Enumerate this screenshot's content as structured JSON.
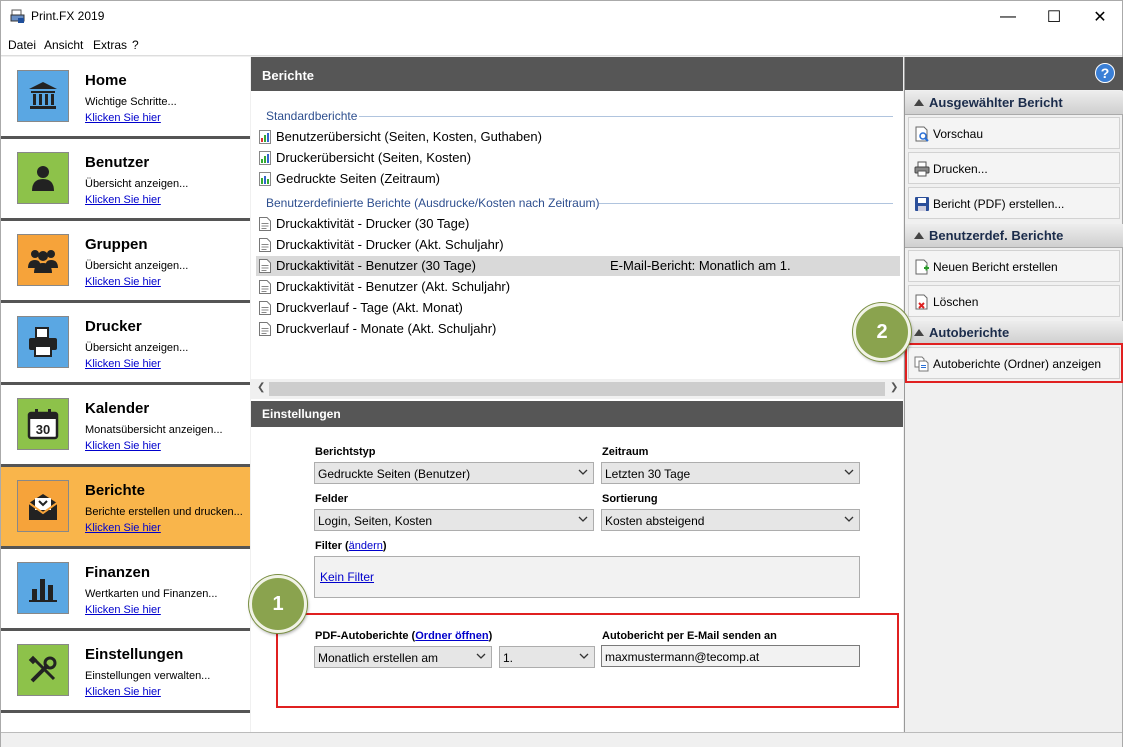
{
  "window": {
    "title": "Print.FX 2019",
    "minimize": "—",
    "maximize": "☐",
    "close": "✕"
  },
  "menu": [
    "Datei",
    "Ansicht",
    "Extras",
    "?"
  ],
  "nav": [
    {
      "title": "Home",
      "desc": "Wichtige Schritte...",
      "link": "Klicken Sie hier",
      "color": "#5aa7e3",
      "icon": "bank-icon"
    },
    {
      "title": "Benutzer",
      "desc": "Übersicht anzeigen...",
      "link": "Klicken Sie hier",
      "color": "#8dc24a",
      "icon": "user-icon"
    },
    {
      "title": "Gruppen",
      "desc": "Übersicht anzeigen...",
      "link": "Klicken Sie hier",
      "color": "#f6a33a",
      "icon": "group-icon"
    },
    {
      "title": "Drucker",
      "desc": "Übersicht anzeigen...",
      "link": "Klicken Sie hier",
      "color": "#5aa7e3",
      "icon": "printer-icon"
    },
    {
      "title": "Kalender",
      "desc": "Monatsübersicht anzeigen...",
      "link": "Klicken Sie hier",
      "color": "#8dc24a",
      "icon": "calendar-icon"
    },
    {
      "title": "Berichte",
      "desc": "Berichte erstellen und drucken...",
      "link": "Klicken Sie hier",
      "color": "#f6a33a",
      "icon": "report-icon",
      "active": true
    },
    {
      "title": "Finanzen",
      "desc": "Wertkarten und Finanzen...",
      "link": "Klicken Sie hier",
      "color": "#5aa7e3",
      "icon": "finance-icon"
    },
    {
      "title": "Einstellungen",
      "desc": "Einstellungen verwalten...",
      "link": "Klicken Sie hier",
      "color": "#8dc24a",
      "icon": "tools-icon"
    }
  ],
  "reports": {
    "header": "Berichte",
    "standard_heading": "Standardberichte",
    "standard": [
      "Benutzerübersicht (Seiten, Kosten, Guthaben)",
      "Druckerübersicht (Seiten, Kosten)",
      "Gedruckte Seiten (Zeitraum)"
    ],
    "custom_heading": "Benutzerdefinierte Berichte (Ausdrucke/Kosten nach Zeitraum)",
    "custom": [
      {
        "label": "Druckaktivität - Drucker (30 Tage)",
        "email": ""
      },
      {
        "label": "Druckaktivität - Drucker (Akt. Schuljahr)",
        "email": ""
      },
      {
        "label": "Druckaktivität - Benutzer (30 Tage)",
        "email": "E-Mail-Bericht: Monatlich am 1.",
        "selected": true
      },
      {
        "label": "Druckaktivität - Benutzer (Akt. Schuljahr)",
        "email": ""
      },
      {
        "label": "Druckverlauf - Tage (Akt. Monat)",
        "email": ""
      },
      {
        "label": "Druckverlauf - Monate (Akt. Schuljahr)",
        "email": ""
      }
    ]
  },
  "settings": {
    "header": "Einstellungen",
    "berichtstyp_label": "Berichtstyp",
    "berichtstyp_value": "Gedruckte Seiten (Benutzer)",
    "zeitraum_label": "Zeitraum",
    "zeitraum_value": "Letzten 30 Tage",
    "felder_label": "Felder",
    "felder_value": "Login, Seiten, Kosten",
    "sortierung_label": "Sortierung",
    "sortierung_value": "Kosten absteigend",
    "filter_label": "Filter (",
    "filter_change": "ändern",
    "filter_close": ")",
    "filter_value": "Kein Filter",
    "pdf_label": "PDF-Autoberichte (",
    "pdf_link": "Ordner öffnen",
    "pdf_close": ")",
    "pdf_mode": "Monatlich erstellen am",
    "pdf_day": "1.",
    "email_label": "Autobericht per E-Mail senden an",
    "email_value": "maxmustermann@tecomp.at"
  },
  "right": {
    "help": "?",
    "section1": "Ausgewählter Bericht",
    "vorschau": "Vorschau",
    "drucken": "Drucken...",
    "pdf": "Bericht (PDF) erstellen...",
    "section2": "Benutzerdef. Berichte",
    "neu": "Neuen Bericht erstellen",
    "loeschen": "Löschen",
    "section3": "Autoberichte",
    "auto": "Autoberichte (Ordner) anzeigen"
  },
  "badges": {
    "one": "1",
    "two": "2"
  }
}
